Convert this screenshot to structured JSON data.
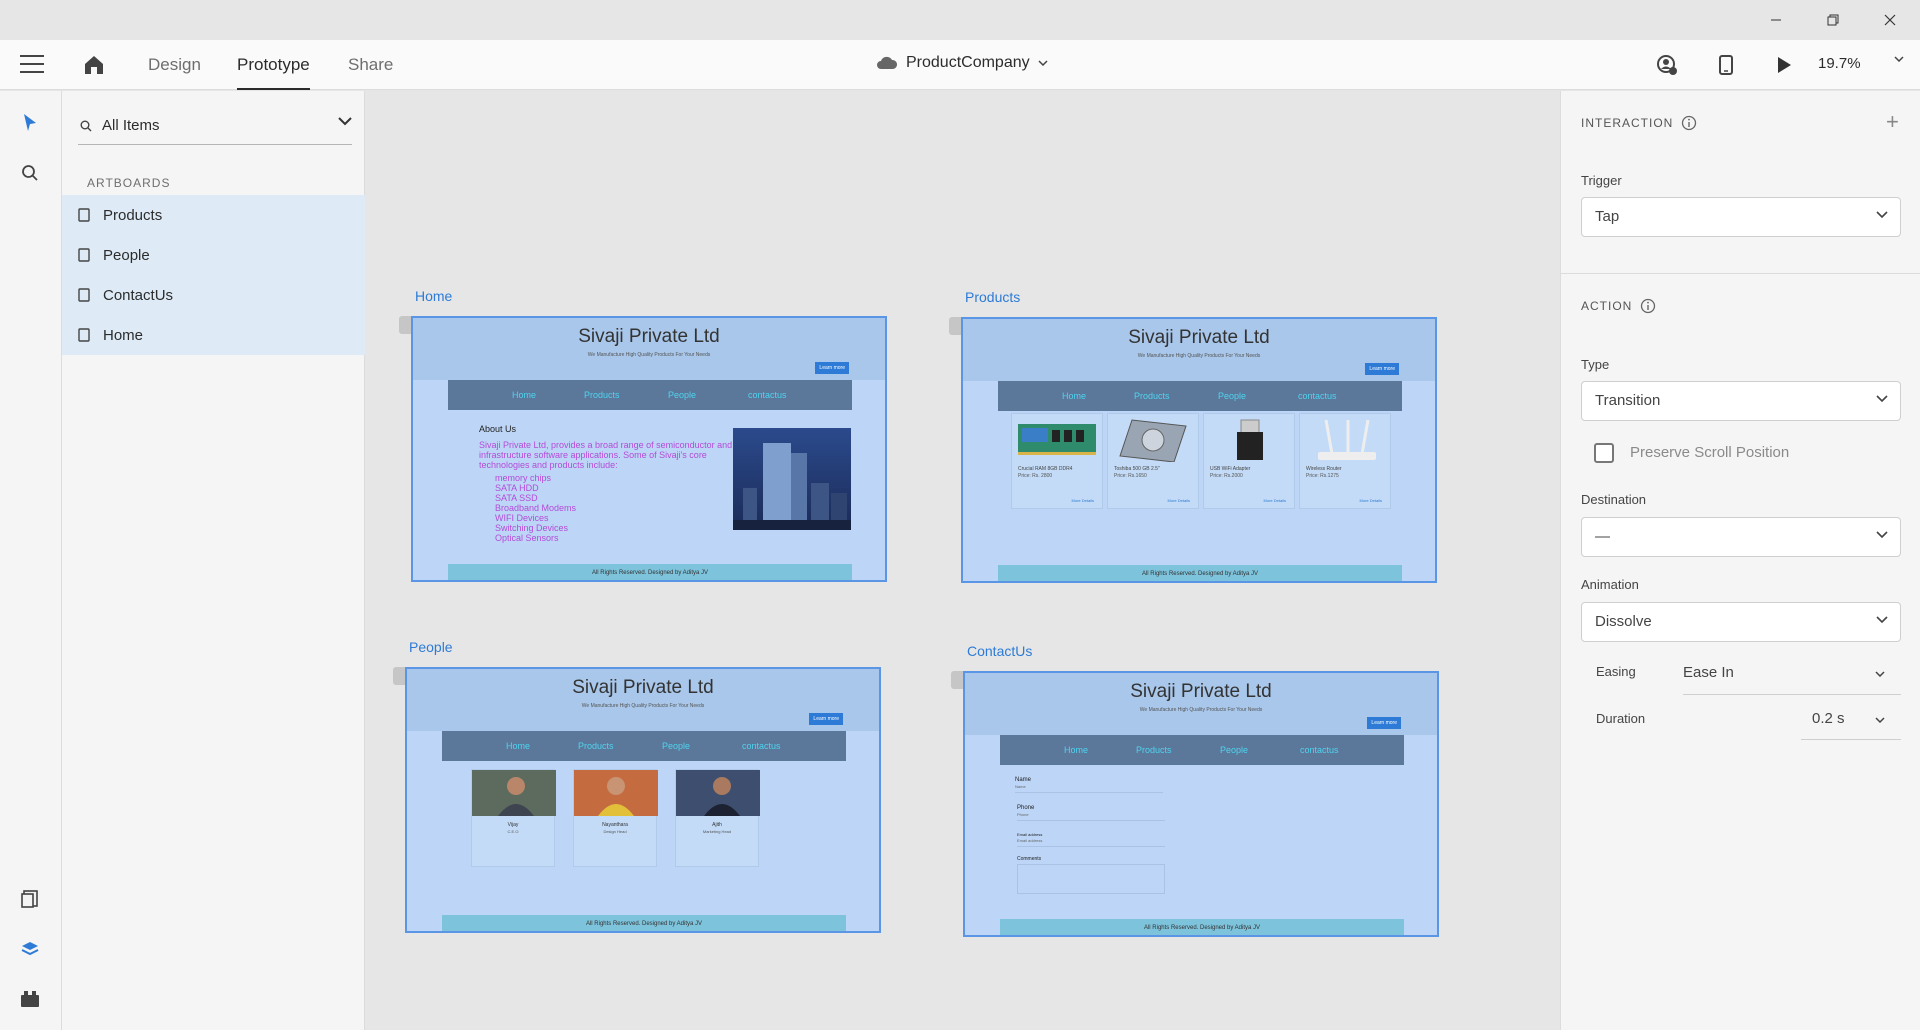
{
  "header": {
    "tabs": [
      {
        "label": "Design",
        "active": false
      },
      {
        "label": "Prototype",
        "active": true
      },
      {
        "label": "Share",
        "active": false
      }
    ],
    "document": "ProductCompany",
    "zoom": "19.7%"
  },
  "layers": {
    "filter": "All Items",
    "section": "ARTBOARDS",
    "artboards": [
      "Products",
      "People",
      "ContactUs",
      "Home"
    ]
  },
  "canvas": {
    "artboards": {
      "home": {
        "label": "Home",
        "site_title": "Sivaji Private Ltd",
        "tagline": "We Manufacture High Quality Products For Your Needs",
        "learn": "Learn more",
        "nav": [
          "Home",
          "Products",
          "People",
          "contactus"
        ],
        "about_heading": "About Us",
        "about_text": "Sivaji Private Ltd, provides a broad range of semiconductor and infrastructure software applications. Some of Sivaji's core technologies and products include:",
        "about_list": [
          "memory chips",
          "SATA HDD",
          "SATA SSD",
          "Broadband Modems",
          "WIFI Devices",
          "Switching Devices",
          "Optical Sensors"
        ],
        "footer": "All Rights Reserved. Designed by Aditya JV"
      },
      "products": {
        "label": "Products",
        "site_title": "Sivaji Private Ltd",
        "tagline": "We Manufacture High Quality Products For Your Needs",
        "learn": "Learn more",
        "nav": [
          "Home",
          "Products",
          "People",
          "contactus"
        ],
        "items": [
          {
            "name": "Crucial RAM 8GB DDR4",
            "price": "Price: Rs. 2800",
            "more": "More Details"
          },
          {
            "name": "Toshiba 500 GB 2.5\"",
            "price": "Price: Rs.1650",
            "more": "More Details"
          },
          {
            "name": "USB WiFi Adapter",
            "price": "Price: Rs.2000",
            "more": "More Details"
          },
          {
            "name": "Wireless Router",
            "price": "Price: Rs.1275",
            "more": "More Details"
          }
        ],
        "footer": "All Rights Reserved. Designed by Aditya JV"
      },
      "people": {
        "label": "People",
        "site_title": "Sivaji Private Ltd",
        "tagline": "We Manufacture High Quality Products For Your Needs",
        "learn": "Learn more",
        "nav": [
          "Home",
          "Products",
          "People",
          "contactus"
        ],
        "persons": [
          {
            "name": "Vijay",
            "role": "C.E.O"
          },
          {
            "name": "Nayanthara",
            "role": "Design Head"
          },
          {
            "name": "Ajith",
            "role": "Marketing Head"
          }
        ],
        "footer": "All Rights Reserved. Designed by Aditya JV"
      },
      "contact": {
        "label": "ContactUs",
        "site_title": "Sivaji Private Ltd",
        "tagline": "We Manufacture High Quality Products For Your Needs",
        "learn": "Learn more",
        "nav": [
          "Home",
          "Products",
          "People",
          "contactus"
        ],
        "fields": [
          {
            "label": "Name",
            "placeholder": "Name"
          },
          {
            "label": "Phone",
            "placeholder": "Phone"
          },
          {
            "label": "Email address",
            "placeholder": "Email address"
          },
          {
            "label": "Comments",
            "placeholder": ""
          }
        ],
        "footer": "All Rights Reserved. Designed by Aditya JV"
      }
    }
  },
  "panel": {
    "interaction": {
      "title": "INTERACTION",
      "trigger_label": "Trigger",
      "trigger": "Tap"
    },
    "action": {
      "title": "ACTION",
      "type_label": "Type",
      "type": "Transition",
      "preserve_scroll": "Preserve Scroll Position",
      "preserve_checked": false,
      "destination_label": "Destination",
      "destination": "—",
      "animation_label": "Animation",
      "animation": "Dissolve",
      "easing_label": "Easing",
      "easing": "Ease In",
      "duration_label": "Duration",
      "duration": "0.2 s"
    }
  },
  "colors": {
    "accent": "#2d7bd6",
    "artboard_bg": "#bdd6f7",
    "nav_bg": "#5b7799",
    "nav_text": "#4fd4f0",
    "about_text": "#b44bd8",
    "footer_bg": "#7ec3dc",
    "selected_row": "#deebf7"
  }
}
